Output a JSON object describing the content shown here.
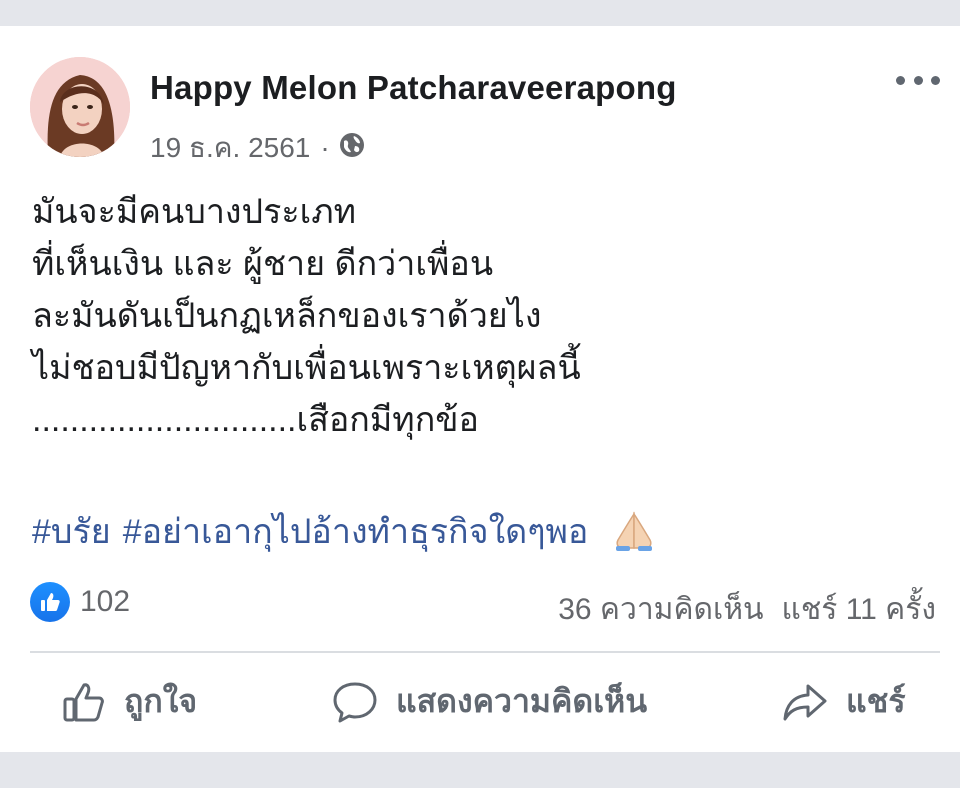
{
  "post": {
    "author": "Happy Melon Patcharaveerapong",
    "date": "19 ธ.ค. 2561",
    "separator": "·",
    "privacy_icon": "globe-icon",
    "more_icon": "more-options-icon",
    "body_lines": [
      "มันจะมีคนบางประเภท",
      "ที่เห็นเงิน และ ผู้ชาย ดีกว่าเพื่อน",
      "ละมันดันเป็นกฏเหล็กของเราด้วยไง",
      "ไม่ชอบมีปัญหากับเพื่อนเพราะเหตุผลนี้",
      "............................เสือกมีทุกข้อ"
    ],
    "hashtags": [
      "#บรัย",
      "#อย่าเอากุไปอ้างทำธุรกิจใดๆพอ"
    ],
    "hashtag_emoji": "folded-hands-emoji"
  },
  "stats": {
    "like_icon": "like-reaction-icon",
    "likes": "102",
    "comments": "36 ความคิดเห็น",
    "shares": "แชร์ 11 ครั้ง"
  },
  "actions": {
    "like": {
      "label": "ถูกใจ",
      "icon": "thumbs-up-icon"
    },
    "comment": {
      "label": "แสดงความคิดเห็น",
      "icon": "comment-bubble-icon"
    },
    "share": {
      "label": "แชร์",
      "icon": "share-arrow-icon"
    }
  },
  "colors": {
    "link": "#385898",
    "accent": "#1877f2",
    "secondary_text": "#65676b",
    "frame": "#e4e6eb"
  }
}
